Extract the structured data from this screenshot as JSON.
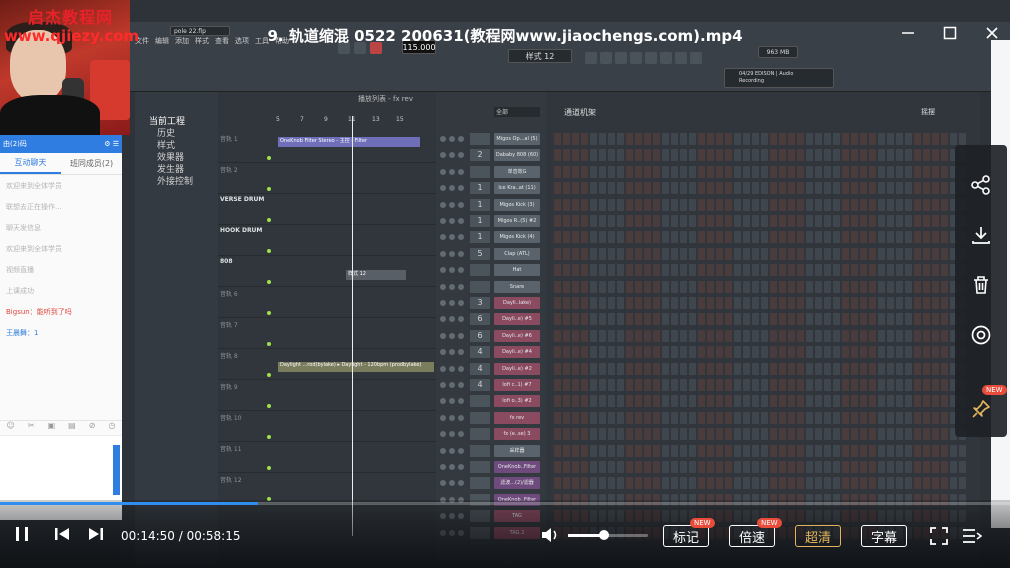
{
  "watermark": {
    "site_name": "启杰教程网",
    "url": "www.qjiezy.com"
  },
  "video_title": "9. 轨道缩混 0522 200631(教程网www.jiaochengs.com).mp4",
  "chat": {
    "header": "由(2)码",
    "tabs": [
      "互动聊天",
      "班同成员(2)"
    ],
    "lines": [
      {
        "text": "欢迎来到全体学员",
        "style": "grey"
      },
      {
        "text": "联想去正在操作...",
        "style": "grey"
      },
      {
        "text": "聊天发信息",
        "style": "grey"
      },
      {
        "text": "欢迎来到全体学员",
        "style": "grey"
      },
      {
        "text": "视频直播",
        "style": "grey"
      },
      {
        "text": "上课成功",
        "style": "grey"
      },
      {
        "text": "Bigsun：能听到了吗",
        "style": "red"
      },
      {
        "text": "王晨舞：1",
        "style": "blue"
      }
    ]
  },
  "fl": {
    "menu": [
      "文件",
      "编辑",
      "添加",
      "样式",
      "查看",
      "选项",
      "工具",
      "帮助"
    ],
    "project_file": "pole 22.flp",
    "tempo": "115.000",
    "pattern": "样式 12",
    "memory": "963 MB",
    "hint_line1": "04/29  EDISON | Audio",
    "hint_line2": "Recording",
    "browser_title": "当前工程",
    "browser_items": [
      "历史",
      "样式",
      "效果器",
      "发生器",
      "外接控制"
    ],
    "playlist_header": "播放列表 - fx rev",
    "playlist_ruler": [
      "5",
      "7",
      "9",
      "11",
      "13",
      "15"
    ],
    "playlist_tracks": [
      {
        "label": "音轨 1",
        "bold": false
      },
      {
        "label": "音轨 2",
        "bold": false
      },
      {
        "label": "VERSE DRUM",
        "bold": true
      },
      {
        "label": "HOOK DRUM",
        "bold": true
      },
      {
        "label": "808",
        "bold": true
      },
      {
        "label": "音轨 6",
        "bold": false
      },
      {
        "label": "音轨 7",
        "bold": false
      },
      {
        "label": "音轨 8",
        "bold": false
      },
      {
        "label": "音轨 9",
        "bold": false
      },
      {
        "label": "音轨 10",
        "bold": false
      },
      {
        "label": "音轨 11",
        "bold": false
      },
      {
        "label": "音轨 12",
        "bold": false
      }
    ],
    "clip_filter": "OneKnob Filter Stereo - 主控 - Filter",
    "clip_daylight": "Daylight ...rod(bylake) ▸ Daylight - 120bpm (prodbylake)",
    "clip_pattern": "样式 12",
    "channel_rack_title": "通道机架",
    "channel_filter": "全部",
    "swing_label": "摇摆",
    "channels": [
      {
        "num": "",
        "name": "Migos Op...al (5)",
        "type": "n"
      },
      {
        "num": "2",
        "name": "Dababy 808 (60)",
        "type": "n"
      },
      {
        "num": "",
        "name": "单音效G",
        "type": "n"
      },
      {
        "num": "1",
        "name": "Ice Kra..at (11)",
        "type": "n"
      },
      {
        "num": "1",
        "name": "Migos Kick (3)",
        "type": "n"
      },
      {
        "num": "1",
        "name": "Migos R..(5) #2",
        "type": "n"
      },
      {
        "num": "1",
        "name": "Migos Kick (4)",
        "type": "n"
      },
      {
        "num": "5",
        "name": "Clap (ATL)",
        "type": "n"
      },
      {
        "num": "",
        "name": "Hat",
        "type": "n"
      },
      {
        "num": "",
        "name": "Snare",
        "type": "n"
      },
      {
        "num": "3",
        "name": "Dayli..lake)",
        "type": "r"
      },
      {
        "num": "6",
        "name": "Dayli..e) #5",
        "type": "r"
      },
      {
        "num": "6",
        "name": "Dayli..e) #6",
        "type": "r"
      },
      {
        "num": "4",
        "name": "Dayli..e) #4",
        "type": "r"
      },
      {
        "num": "4",
        "name": "Dayli..e) #2",
        "type": "r"
      },
      {
        "num": "4",
        "name": "lofi c..1) #7",
        "type": "r"
      },
      {
        "num": "",
        "name": "lofi o..3) #2",
        "type": "r"
      },
      {
        "num": "",
        "name": "fx rev",
        "type": "r"
      },
      {
        "num": "",
        "name": "fx (e..se) 3",
        "type": "r"
      },
      {
        "num": "",
        "name": "采样器",
        "type": "n"
      },
      {
        "num": "",
        "name": "OneKnob..Filter",
        "type": "p"
      },
      {
        "num": "",
        "name": "滤波...(2)/滤器",
        "type": "p"
      },
      {
        "num": "",
        "name": "OneKnob..Filter",
        "type": "p"
      },
      {
        "num": "",
        "name": "TAG",
        "type": "r"
      },
      {
        "num": "",
        "name": "TAG 2",
        "type": "r"
      }
    ]
  },
  "player": {
    "current_time": "00:14:50",
    "separator": " / ",
    "total_time": "00:58:15",
    "progress_fraction": 0.255,
    "volume_fraction": 0.45,
    "buttons": {
      "mark": "标记",
      "speed": "倍速",
      "quality": "超清",
      "subtitle": "字幕"
    },
    "new_badge": "NEW"
  },
  "side_panel": {
    "new_badge": "NEW"
  },
  "colors": {
    "accent": "#2f8ef0",
    "quality_gold": "#e3b45b",
    "badge_red": "#e94c3b"
  }
}
